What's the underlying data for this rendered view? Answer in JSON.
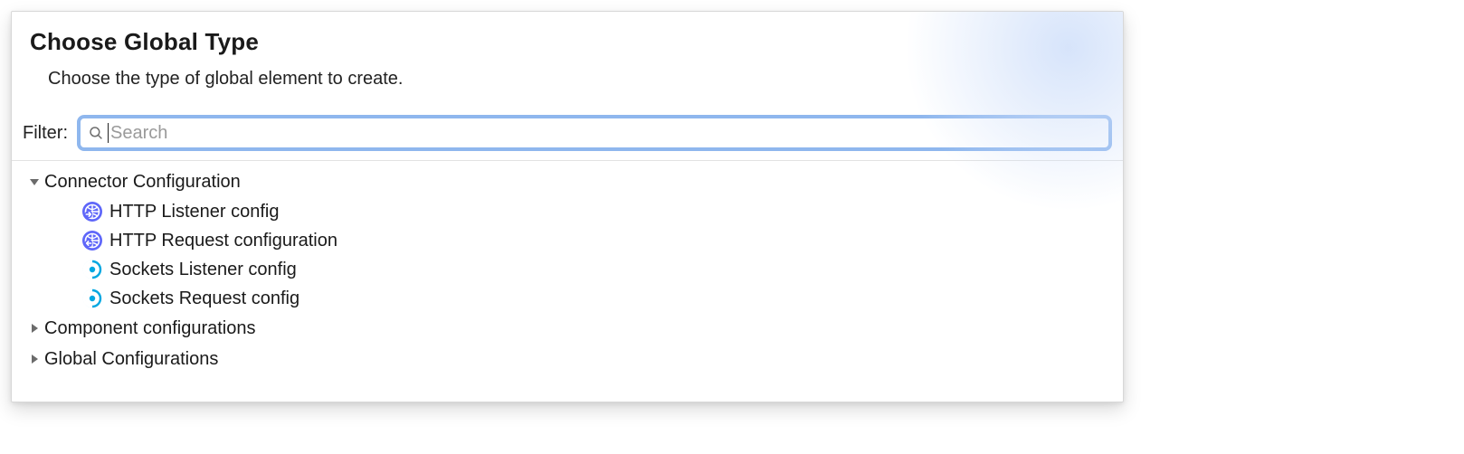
{
  "dialog": {
    "title": "Choose Global Type",
    "subtitle": "Choose the type of global element to create."
  },
  "filter": {
    "label": "Filter:",
    "placeholder": "Search",
    "value": ""
  },
  "tree": {
    "groups": [
      {
        "label": "Connector Configuration",
        "expanded": true,
        "items": [
          {
            "label": "HTTP Listener config",
            "icon": "globe-in-icon"
          },
          {
            "label": "HTTP Request configuration",
            "icon": "globe-out-icon"
          },
          {
            "label": "Sockets Listener config",
            "icon": "socket-icon"
          },
          {
            "label": "Sockets Request config",
            "icon": "socket-icon"
          }
        ]
      },
      {
        "label": "Component configurations",
        "expanded": false,
        "items": []
      },
      {
        "label": "Global Configurations",
        "expanded": false,
        "items": []
      }
    ]
  }
}
